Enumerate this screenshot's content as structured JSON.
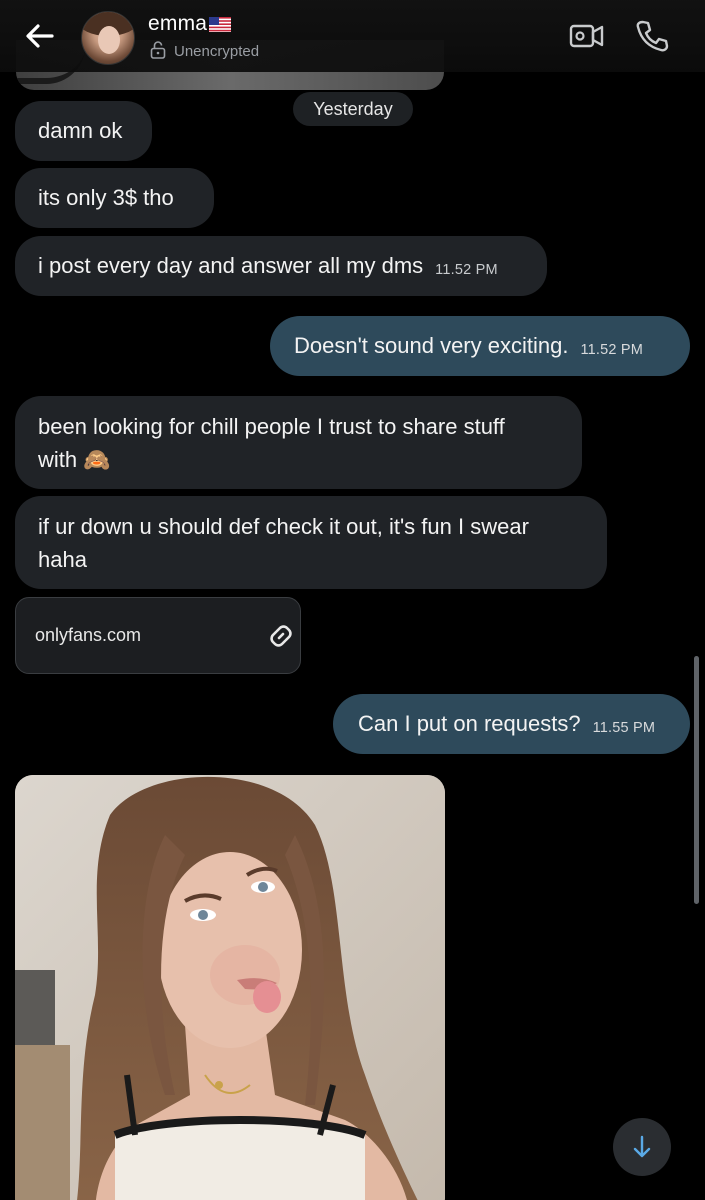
{
  "header": {
    "contact_name": "emma",
    "flag_emoji": "🇺🇸",
    "encryption_status": "Unencrypted",
    "icons": [
      "back-arrow-icon",
      "avatar",
      "lock-open-icon",
      "video-call-icon",
      "phone-icon"
    ]
  },
  "day_separator": "Yesterday",
  "messages": [
    {
      "text": "damn ok",
      "time": ""
    },
    {
      "text": "its only 3$ tho",
      "time": ""
    },
    {
      "text": "i post every day and answer all my dms",
      "time": "11.52 PM"
    },
    {
      "text": "Doesn't sound very exciting.",
      "time": "11.52 PM"
    },
    {
      "line1": "been looking for chill people I trust to share stuff",
      "line2": "with 🙈",
      "time": ""
    },
    {
      "line1": "if ur down u should def check it out, it's fun I swear",
      "line2": "haha",
      "time": ""
    },
    {
      "text": "Can I put on requests?",
      "time": "11.55 PM"
    }
  ],
  "link_preview": {
    "url_text": "onlyfans.com"
  },
  "colors": {
    "background": "#000000",
    "incoming_bubble": "#202327",
    "outgoing_bubble": "#2e4a5b",
    "accent": "#5aa9e6"
  }
}
